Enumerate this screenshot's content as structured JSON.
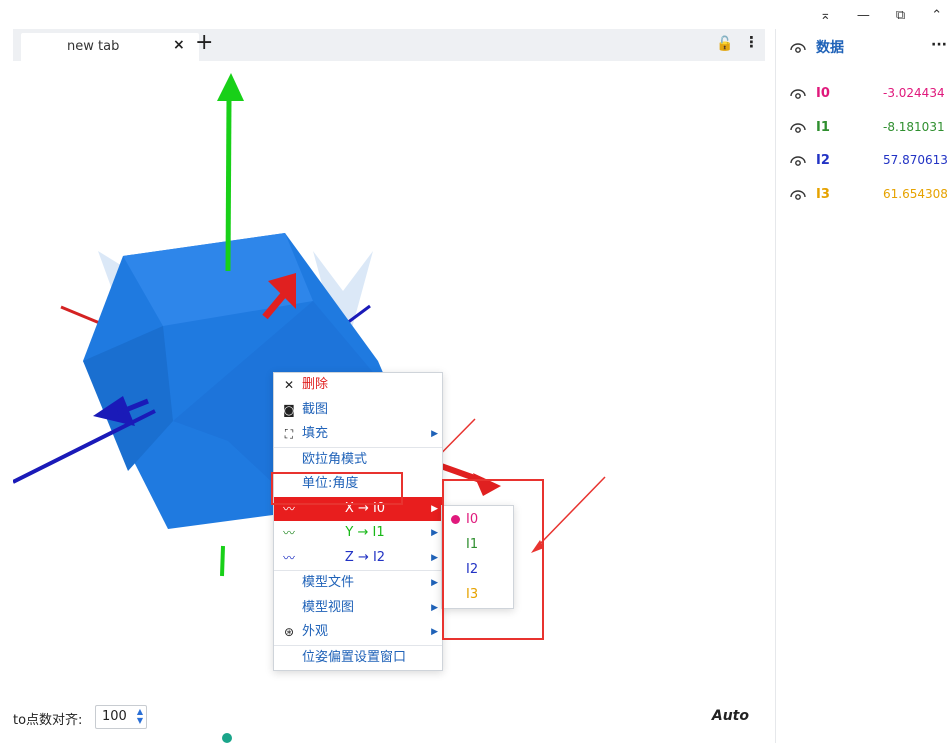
{
  "window": {
    "pin": "⌅",
    "minimize": "—",
    "restore": "⧉",
    "expand": "⌃"
  },
  "tab": {
    "title": "new tab",
    "close": "×",
    "add": "+"
  },
  "toolbar": {
    "lock": "🔓",
    "more": "⋮"
  },
  "context_menu": {
    "items": [
      {
        "icon": "✕",
        "label": "删除"
      },
      {
        "icon": "◙",
        "label": "截图"
      },
      {
        "icon": "⛶",
        "label": "填充"
      },
      {
        "label": "欧拉角模式"
      },
      {
        "label": "单位:角度"
      },
      {
        "label": "X → I0"
      },
      {
        "label": "Y → I1"
      },
      {
        "label": "Z → I2"
      },
      {
        "label": "模型文件"
      },
      {
        "label": "模型视图"
      },
      {
        "icon": "⊛",
        "label": "外观"
      },
      {
        "label": "位姿偏置设置窗口"
      }
    ]
  },
  "submenu": {
    "items": [
      "I0",
      "I1",
      "I2",
      "I3"
    ]
  },
  "bottom": {
    "align_label": "to点数对齐:",
    "align_value": "100",
    "spin_up": "▲",
    "spin_down": "▼",
    "mode": "Auto"
  },
  "panel": {
    "title": "数据",
    "more": "···",
    "rows": [
      {
        "name": "I0",
        "value": "-3.024434",
        "color": "#e0197c"
      },
      {
        "name": "I1",
        "value": "-8.181031",
        "color": "#2f8f2f"
      },
      {
        "name": "I2",
        "value": "57.870613",
        "color": "#2233c4"
      },
      {
        "name": "I3",
        "value": "61.654308",
        "color": "#e6a200"
      }
    ]
  }
}
